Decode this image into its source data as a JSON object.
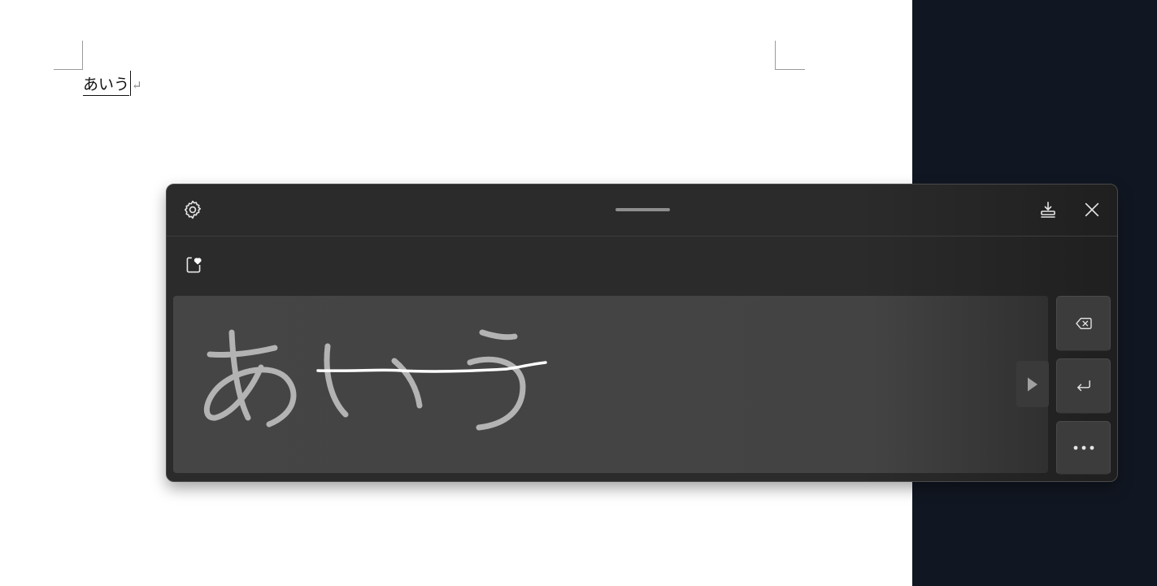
{
  "document": {
    "text": "あいう",
    "paragraph_mark": "↵"
  },
  "handwriting_panel": {
    "icons": {
      "settings": "gear-icon",
      "drag_handle": "drag-handle",
      "dock": "dock-icon",
      "close": "close-icon",
      "clipboard": "clipboard-heart-icon",
      "candidate_next": "play-arrow-icon",
      "backspace": "backspace-icon",
      "enter": "enter-icon",
      "more": "more-icon"
    },
    "colors": {
      "panel_bg": "#2b2b2b",
      "writing_area_bg": "#454545",
      "ink_gray": "#b3b3b3",
      "ink_white": "#ffffff",
      "desktop_bg": "#111722"
    },
    "handwritten_ink": "あいう"
  }
}
